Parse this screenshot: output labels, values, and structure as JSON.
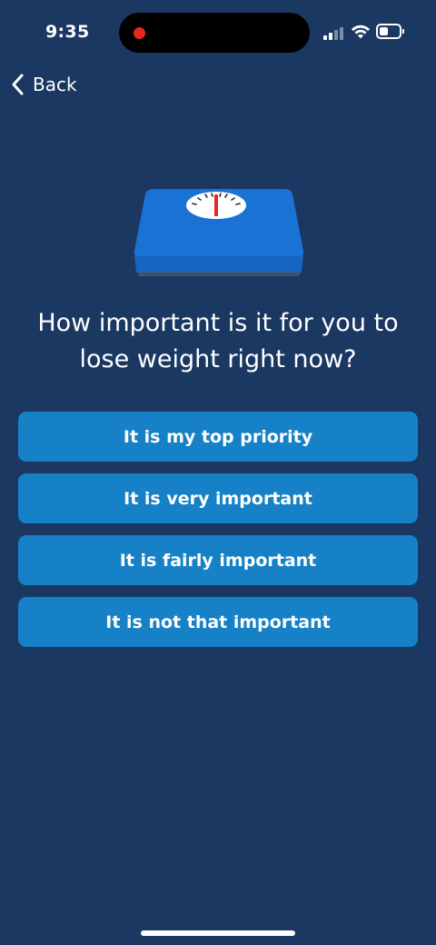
{
  "status_bar": {
    "time": "9:35"
  },
  "nav": {
    "back_label": "Back"
  },
  "question": "How important is it for you to lose weight right now?",
  "options": [
    {
      "label": "It is my top priority"
    },
    {
      "label": "It is very important"
    },
    {
      "label": "It is fairly important"
    },
    {
      "label": "It is not that important"
    }
  ],
  "colors": {
    "background": "#1b3862",
    "button": "#1681c6",
    "scale_top": "#1a73d4",
    "scale_needle": "#e5281f"
  },
  "icons": [
    "record-dot-icon",
    "signal-icon",
    "wifi-icon",
    "battery-icon",
    "back-chevron-icon",
    "bathroom-scale-icon"
  ]
}
